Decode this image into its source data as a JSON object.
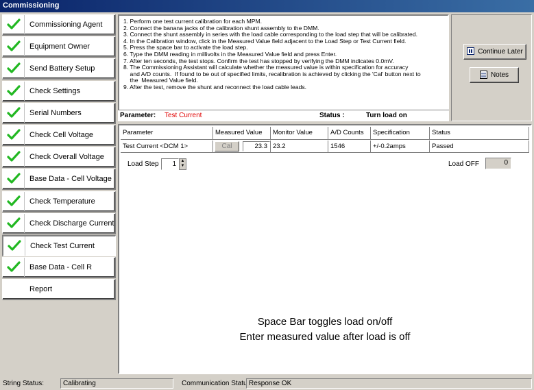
{
  "window": {
    "title": "Commissioning"
  },
  "sidebar": {
    "items": [
      {
        "label": "Commissioning Agent",
        "checked": true,
        "active": false
      },
      {
        "label": "Equipment Owner",
        "checked": true,
        "active": false
      },
      {
        "label": "Send Battery Setup",
        "checked": true,
        "active": false
      },
      {
        "label": "Check Settings",
        "checked": true,
        "active": false
      },
      {
        "label": "Serial Numbers",
        "checked": true,
        "active": false
      },
      {
        "label": "Check Cell Voltage",
        "checked": true,
        "active": false
      },
      {
        "label": "Check Overall Voltage",
        "checked": true,
        "active": false
      },
      {
        "label": "Base Data - Cell Voltage",
        "checked": true,
        "active": false
      },
      {
        "label": "Check Temperature",
        "checked": true,
        "active": false
      },
      {
        "label": "Check Discharge Current",
        "checked": true,
        "active": false
      },
      {
        "label": "Check Test Current",
        "checked": true,
        "active": true
      },
      {
        "label": "Base Data - Cell R",
        "checked": true,
        "active": false
      },
      {
        "label": "Report",
        "checked": false,
        "active": false
      }
    ]
  },
  "instructions": {
    "lines": [
      "1. Perform one test current calibration for each MPM.",
      "2. Connect the banana jacks of the calibration shunt assembly to the DMM.",
      "3. Connect the shunt assembly in series with the load cable corresponding to the load step that will be calibrated.",
      "4. In the Calibration window, click in the Measured Value field adjacent to the Load Step or Test Current field.",
      "5. Press the space bar to activate the load step.",
      "6. Type the DMM reading in millivolts in the Measured Value field and press Enter.",
      "7. After ten seconds, the test stops. Confirm the test has stopped by verifying the DMM indicates 0.0mV.",
      "8. The Commissioning Assistant will calculate whether the measured value is within specification for accuracy",
      "    and A/D counts.  If found to be out of specified limits, recalibration is achieved by clicking the 'Cal' button next to",
      "    the  Measured Value field.",
      "9. After the test, remove the shunt and reconnect the load cable leads."
    ]
  },
  "parameter_line": {
    "parameter_label": "Parameter:",
    "parameter_value": "Test Current",
    "status_label": "Status :",
    "status_value": "Turn load on"
  },
  "buttons": {
    "continue_later": "Continue Later",
    "notes": "Notes"
  },
  "table": {
    "headers": [
      "Parameter",
      "Measured Value",
      "Monitor Value",
      "A/D Counts",
      "Specification",
      "Status"
    ],
    "row": {
      "parameter": "Test Current <DCM 1>",
      "cal_label": "Cal",
      "measured_value": "23.3",
      "monitor_value": "23.2",
      "ad_counts": "1546",
      "specification": "+/-0.2amps",
      "status": "Passed"
    }
  },
  "load_step": {
    "label": "Load Step",
    "value": "1"
  },
  "load_off": {
    "label": "Load OFF",
    "value": "0"
  },
  "messages": {
    "line1": "Space Bar toggles load on/off",
    "line2": "Enter measured value after load is off"
  },
  "statusbar": {
    "string_status_label": "String Status:",
    "string_status_value": "Calibrating",
    "comm_status_label": "Communication Status:",
    "comm_status_value": "Response OK"
  },
  "colors": {
    "check": "#22b822",
    "accent_red": "#e00000",
    "titlebar": "#0a246a"
  }
}
